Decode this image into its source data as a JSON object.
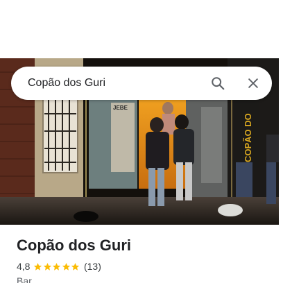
{
  "search": {
    "query": "Copão dos Guri"
  },
  "place": {
    "name": "Copão dos Guri",
    "rating": "4,8",
    "stars": 5,
    "reviews": "(13)",
    "category": "Bar"
  },
  "photo": {
    "sign_text": "JEBE",
    "banner_text": "COPÃO DO"
  },
  "colors": {
    "star": "#fbbc04",
    "icon": "#5f6368",
    "text": "#202124"
  },
  "icons": {
    "search": "search-icon",
    "close": "close-icon",
    "star": "star-icon"
  }
}
